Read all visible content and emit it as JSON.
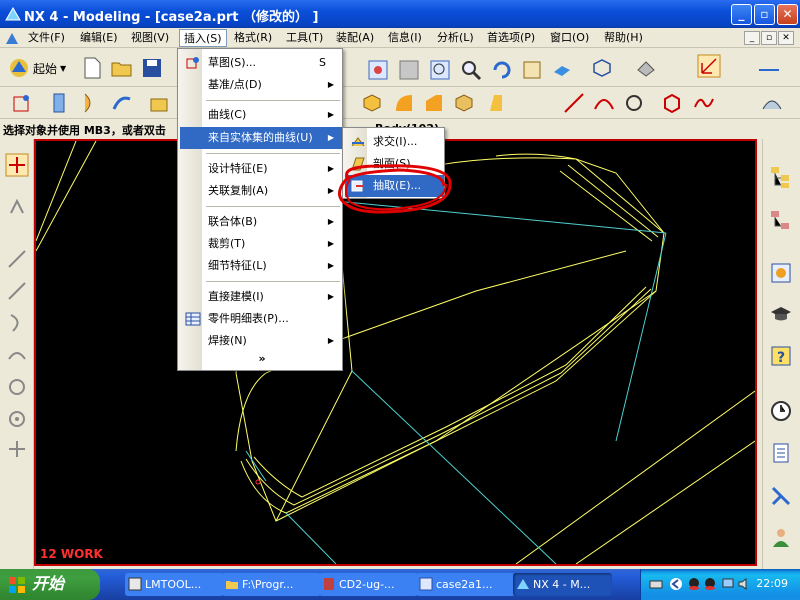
{
  "window": {
    "title": "NX 4 - Modeling - [case2a.prt （修改的） ]",
    "min_label": "_",
    "max_label": "▫",
    "close_label": "✕"
  },
  "menubar": {
    "items": [
      "文件(F)",
      "编辑(E)",
      "视图(V)",
      "插入(S)",
      "格式(R)",
      "工具(T)",
      "装配(A)",
      "信息(I)",
      "分析(L)",
      "首选项(P)",
      "窗口(O)",
      "帮助(H)"
    ],
    "active_index": 3
  },
  "toolbar": {
    "start_label": "起始"
  },
  "status": {
    "prompt": "选择对象并使用 MB3，或者双击",
    "extra": "Body(102)"
  },
  "insert_menu": {
    "items": [
      {
        "label": "草图(S)...",
        "shortcut": "S",
        "submenu": false,
        "icon": "sketch-icon"
      },
      {
        "label": "基准/点(D)",
        "submenu": true
      },
      {
        "label": "曲线(C)",
        "submenu": true
      },
      {
        "label": "来自实体集的曲线(U)",
        "submenu": true,
        "highlighted": true
      },
      {
        "label": "设计特征(E)",
        "submenu": true
      },
      {
        "label": "关联复制(A)",
        "submenu": true
      },
      {
        "label": "联合体(B)",
        "submenu": true
      },
      {
        "label": "裁剪(T)",
        "submenu": true
      },
      {
        "label": "细节特征(L)",
        "submenu": true
      },
      {
        "label": "直接建模(I)",
        "submenu": true
      },
      {
        "label": "零件明细表(P)...",
        "submenu": false,
        "icon": "parts-list-icon"
      },
      {
        "label": "焊接(N)",
        "submenu": true
      }
    ],
    "expand_label": "»"
  },
  "sub_menu": {
    "items": [
      {
        "label": "求交(I)...",
        "icon": "intersect-icon"
      },
      {
        "label": "剖面(S)...",
        "icon": "section-icon"
      },
      {
        "label": "抽取(E)...",
        "icon": "extract-icon",
        "highlighted": true
      }
    ]
  },
  "viewport": {
    "work_label": "12 WORK"
  },
  "taskbar": {
    "start_label": "开始",
    "tasks": [
      {
        "label": "LMTOOL...",
        "active": false
      },
      {
        "label": "F:\\Progr...",
        "active": false
      },
      {
        "label": "CD2-ug-...",
        "active": false
      },
      {
        "label": "case2a1...",
        "active": false
      },
      {
        "label": "NX 4 - M...",
        "active": true
      }
    ],
    "clock": "22:09"
  },
  "colors": {
    "accent": "#316ac5",
    "viewport_bg": "#000000",
    "curve": "#ffff66",
    "edge": "#4fd0d0",
    "annotation": "#e00000"
  }
}
